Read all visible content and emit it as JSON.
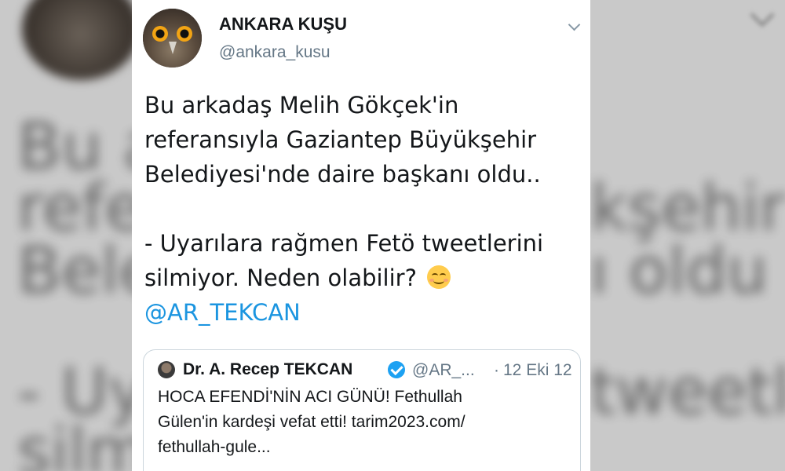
{
  "tweet": {
    "author": {
      "display_name": "ANKARA KUŞU",
      "handle": "@ankara_kusu",
      "avatar_icon": "owl-avatar"
    },
    "menu_icon": "chevron-down-icon",
    "text_lines": [
      "Bu arkadaş Melih Gökçek'in",
      "referansıyla Gaziantep Büyükşehir",
      "Belediyesi'nde daire başkanı oldu..",
      "- Uyarılara rağmen Fetö tweetlerini",
      "silmiyor. Neden olabilir?"
    ],
    "emoji": "smiling-face-emoji",
    "mention": "@AR_TEKCAN",
    "quoted": {
      "name": "Dr. A. Recep TEKCAN",
      "verified_icon": "verified-badge-icon",
      "handle": "@AR_...",
      "separator": "·",
      "date": "12 Eki 12",
      "text_lines": [
        "HOCA EFENDİ'NİN ACI GÜNÜ! Fethullah",
        "Gülen'in kardeşi vefat etti! tarim2023.com/",
        "fethullah-gule..."
      ]
    }
  },
  "background": {
    "blurred_lines": [
      "Bu a",
      "refer",
      "Bele",
      "- Uya",
      "silmi",
      "kşehir",
      "ı oldu",
      "tweetlerini"
    ]
  },
  "colors": {
    "link": "#1b95e0",
    "secondary_text": "#657786",
    "verified": "#1da1f2",
    "card_border": "#ccd6dd"
  }
}
